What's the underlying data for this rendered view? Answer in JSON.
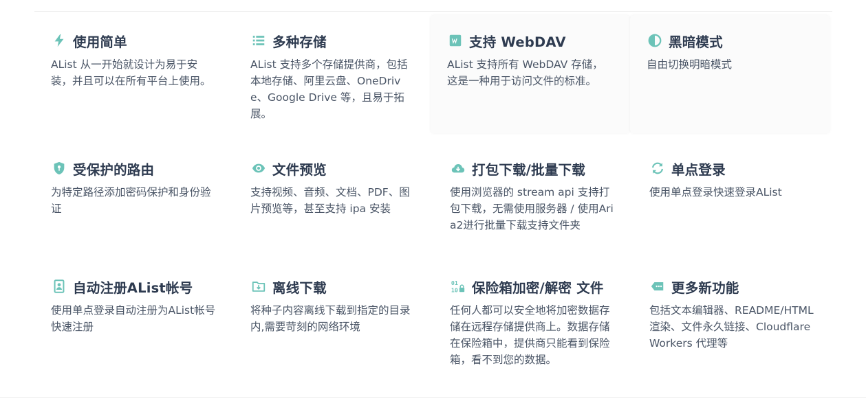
{
  "accent_color": "#6cc3b8",
  "features": [
    {
      "icon": "bolt-icon",
      "title": "使用简单",
      "desc": "AList 从一开始就设计为易于安装，并且可以在所有平台上使用。"
    },
    {
      "icon": "list-icon",
      "title": "多种存储",
      "desc": "AList 支持多个存储提供商，包括本地存储、阿里云盘、OneDrive、Google Drive 等，且易于拓展。"
    },
    {
      "icon": "webdav-icon",
      "title": "支持 WebDAV",
      "desc": "AList 支持所有 WebDAV 存储，这是一种用于访问文件的标准。"
    },
    {
      "icon": "half-moon-icon",
      "title": "黑暗模式",
      "desc": "自由切换明暗模式"
    },
    {
      "icon": "shield-icon",
      "title": "受保护的路由",
      "desc": "为特定路径添加密码保护和身份验证"
    },
    {
      "icon": "eye-icon",
      "title": "文件预览",
      "desc": "支持视频、音频、文档、PDF、图片预览等，甚至支持 ipa 安装"
    },
    {
      "icon": "cloud-download-icon",
      "title": "打包下载/批量下载",
      "desc": "使用浏览器的 stream api 支持打包下载，无需使用服务器 / 使用Aria2进行批量下载支持文件夹"
    },
    {
      "icon": "sync-icon",
      "title": "单点登录",
      "desc": "使用单点登录快速登录AList"
    },
    {
      "icon": "account-box-icon",
      "title": "自动注册AList帐号",
      "desc": "使用单点登录自动注册为AList帐号快速注册"
    },
    {
      "icon": "folder-download-icon",
      "title": "离线下载",
      "desc": "将种子内容离线下载到指定的目录内,需要苛刻的网络环境"
    },
    {
      "icon": "binary-lock-icon",
      "title": "保险箱加密/解密 文件",
      "desc": "任何人都可以安全地将加密数据存储在远程存储提供商上。数据存储在保险箱中，提供商只能看到保险箱，看不到您的数据。"
    },
    {
      "icon": "tag-more-icon",
      "title": "更多新功能",
      "desc": "包括文本编辑器、README/HTML 渲染、文件永久链接、Cloudflare Workers 代理等"
    }
  ]
}
